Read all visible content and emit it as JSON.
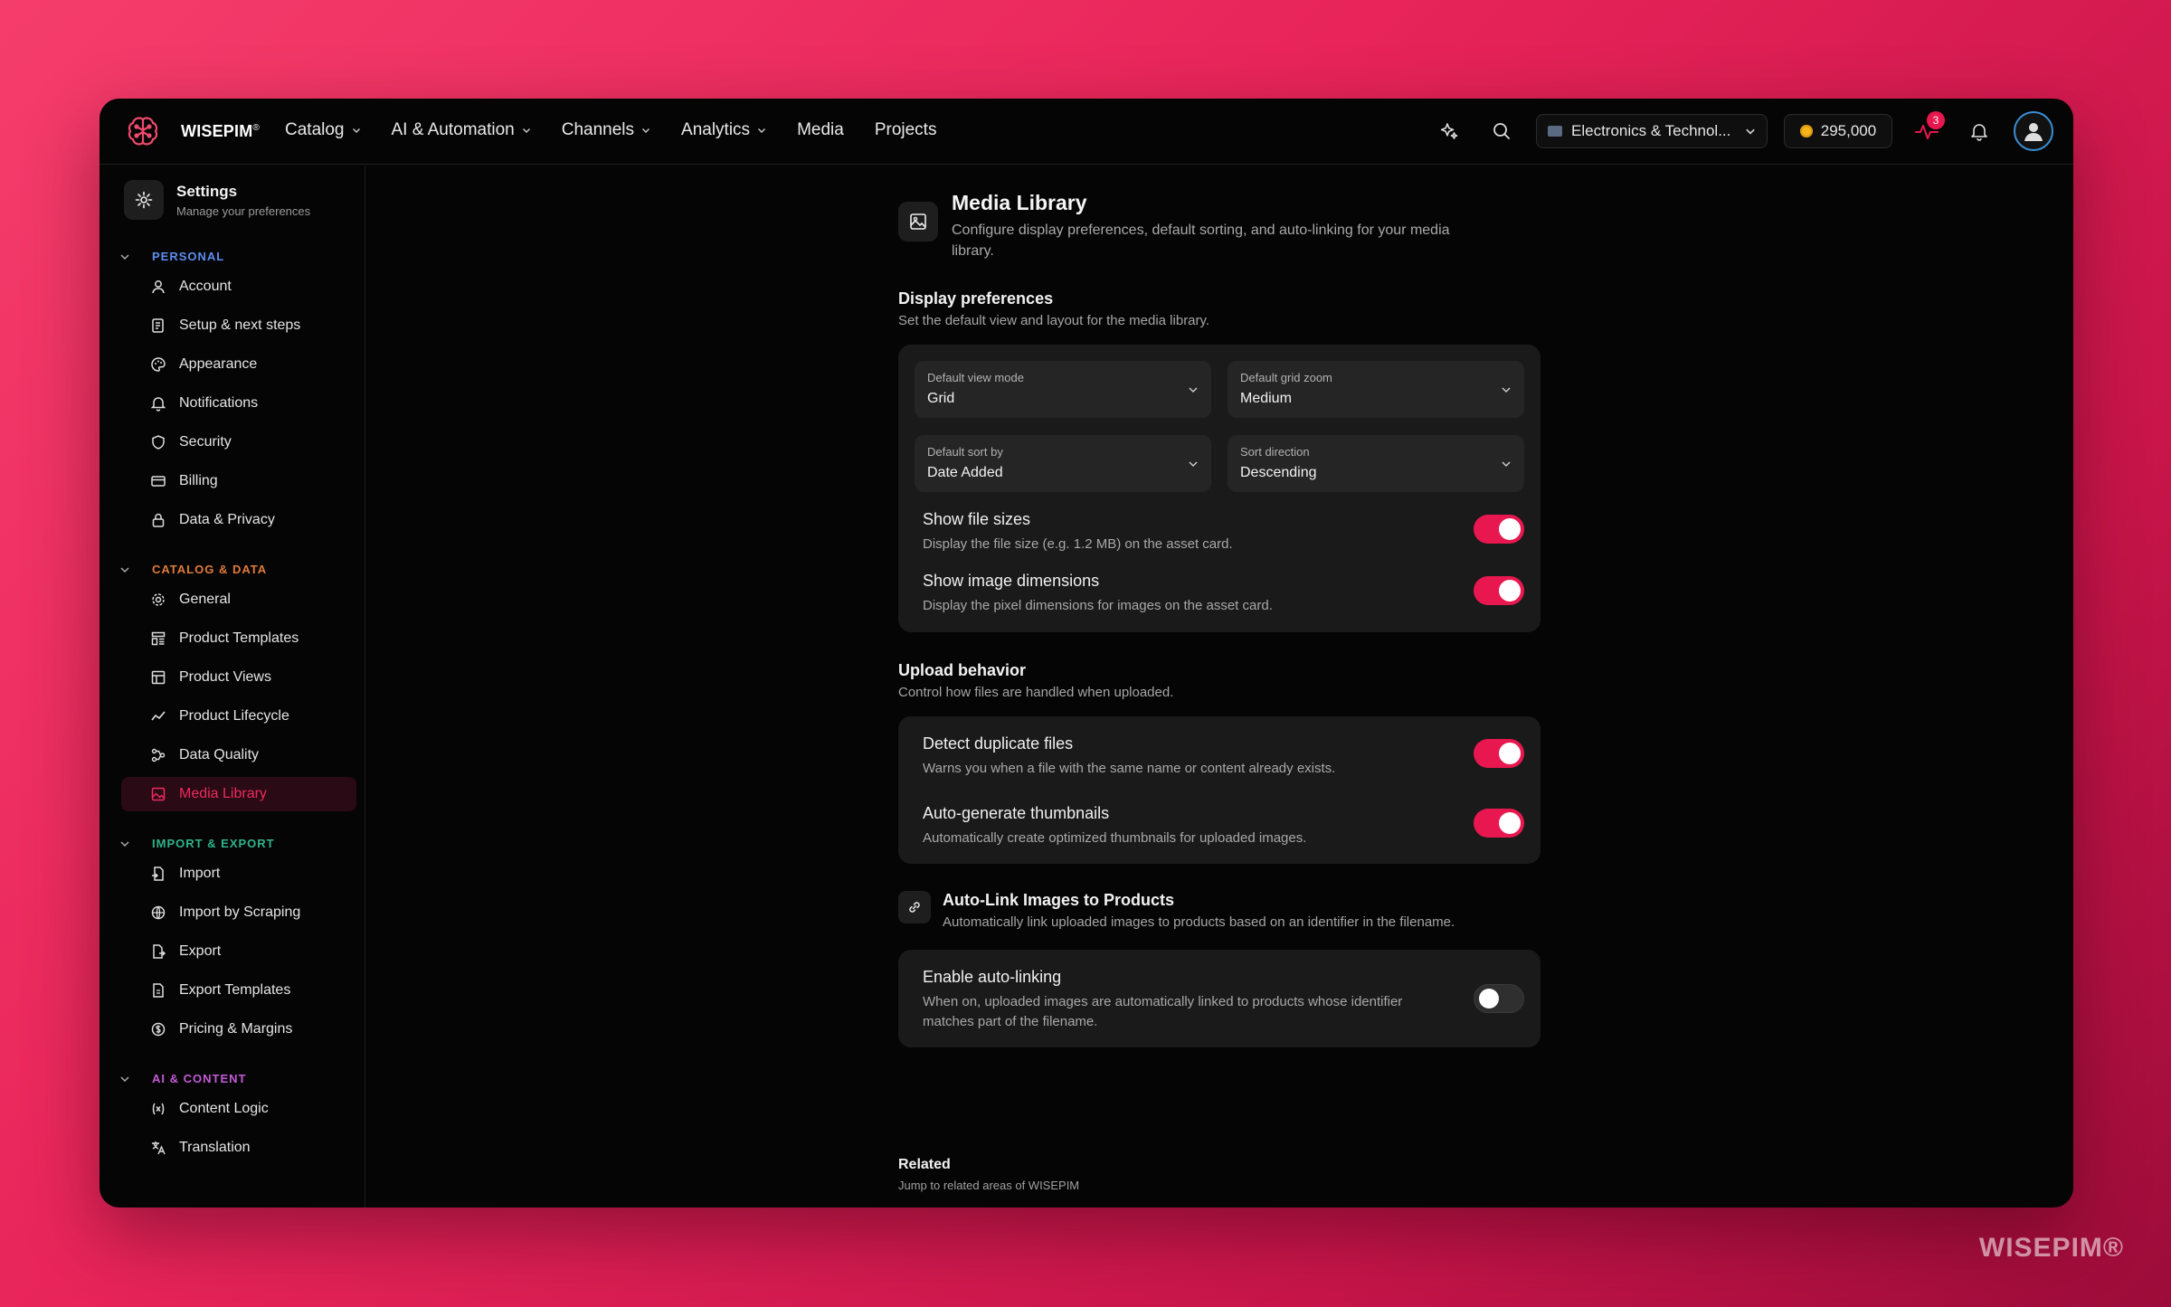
{
  "header": {
    "brand": "WISEPIM",
    "brand_mark": "®",
    "nav": [
      {
        "label": "Catalog",
        "dropdown": true
      },
      {
        "label": "AI & Automation",
        "dropdown": true
      },
      {
        "label": "Channels",
        "dropdown": true
      },
      {
        "label": "Analytics",
        "dropdown": true
      },
      {
        "label": "Media",
        "dropdown": false
      },
      {
        "label": "Projects",
        "dropdown": false
      }
    ],
    "workspace": "Electronics & Technol...",
    "credits": "295,000",
    "activity_badge": "3",
    "accent": "#e8174f"
  },
  "sidebar": {
    "title": "Settings",
    "subtitle": "Manage your preferences",
    "sections": [
      {
        "label": "PERSONAL",
        "color": "#5b8def",
        "items": [
          {
            "label": "Account",
            "icon": "user-icon"
          },
          {
            "label": "Setup & next steps",
            "icon": "checklist-icon"
          },
          {
            "label": "Appearance",
            "icon": "palette-icon"
          },
          {
            "label": "Notifications",
            "icon": "bell-icon"
          },
          {
            "label": "Security",
            "icon": "shield-icon"
          },
          {
            "label": "Billing",
            "icon": "credit-card-icon"
          },
          {
            "label": "Data & Privacy",
            "icon": "lock-icon"
          }
        ]
      },
      {
        "label": "CATALOG & DATA",
        "color": "#e07a3a",
        "items": [
          {
            "label": "General",
            "icon": "gear-icon"
          },
          {
            "label": "Product Templates",
            "icon": "template-icon"
          },
          {
            "label": "Product Views",
            "icon": "table-icon"
          },
          {
            "label": "Product Lifecycle",
            "icon": "trend-icon"
          },
          {
            "label": "Data Quality",
            "icon": "quality-icon"
          },
          {
            "label": "Media Library",
            "icon": "image-icon",
            "active": true
          }
        ]
      },
      {
        "label": "IMPORT & EXPORT",
        "color": "#2fb38a",
        "items": [
          {
            "label": "Import",
            "icon": "file-import-icon"
          },
          {
            "label": "Import by Scraping",
            "icon": "globe-icon"
          },
          {
            "label": "Export",
            "icon": "file-export-icon"
          },
          {
            "label": "Export Templates",
            "icon": "file-template-icon"
          },
          {
            "label": "Pricing & Margins",
            "icon": "dollar-icon"
          }
        ]
      },
      {
        "label": "AI & CONTENT",
        "color": "#c25bd6",
        "items": [
          {
            "label": "Content Logic",
            "icon": "variable-icon"
          },
          {
            "label": "Translation",
            "icon": "translate-icon"
          }
        ]
      }
    ]
  },
  "page": {
    "title": "Media Library",
    "description": "Configure display preferences, default sorting, and auto-linking for your media library.",
    "display": {
      "title": "Display preferences",
      "subtitle": "Set the default view and layout for the media library.",
      "selects": [
        {
          "label": "Default view mode",
          "value": "Grid"
        },
        {
          "label": "Default grid zoom",
          "value": "Medium"
        },
        {
          "label": "Default sort by",
          "value": "Date Added"
        },
        {
          "label": "Sort direction",
          "value": "Descending"
        }
      ],
      "toggles": [
        {
          "title": "Show file sizes",
          "desc": "Display the file size (e.g. 1.2 MB) on the asset card.",
          "on": true
        },
        {
          "title": "Show image dimensions",
          "desc": "Display the pixel dimensions for images on the asset card.",
          "on": true
        }
      ]
    },
    "upload": {
      "title": "Upload behavior",
      "subtitle": "Control how files are handled when uploaded.",
      "toggles": [
        {
          "title": "Detect duplicate files",
          "desc": "Warns you when a file with the same name or content already exists.",
          "on": true
        },
        {
          "title": "Auto-generate thumbnails",
          "desc": "Automatically create optimized thumbnails for uploaded images.",
          "on": true
        }
      ]
    },
    "autolink": {
      "title": "Auto-Link Images to Products",
      "subtitle": "Automatically link uploaded images to products based on an identifier in the filename.",
      "toggle": {
        "title": "Enable auto-linking",
        "desc": "When on, uploaded images are automatically linked to products whose identifier matches part of the filename.",
        "on": false
      }
    },
    "related": {
      "title": "Related",
      "subtitle": "Jump to related areas of WISEPIM"
    }
  },
  "watermark": "WISEPIM®"
}
